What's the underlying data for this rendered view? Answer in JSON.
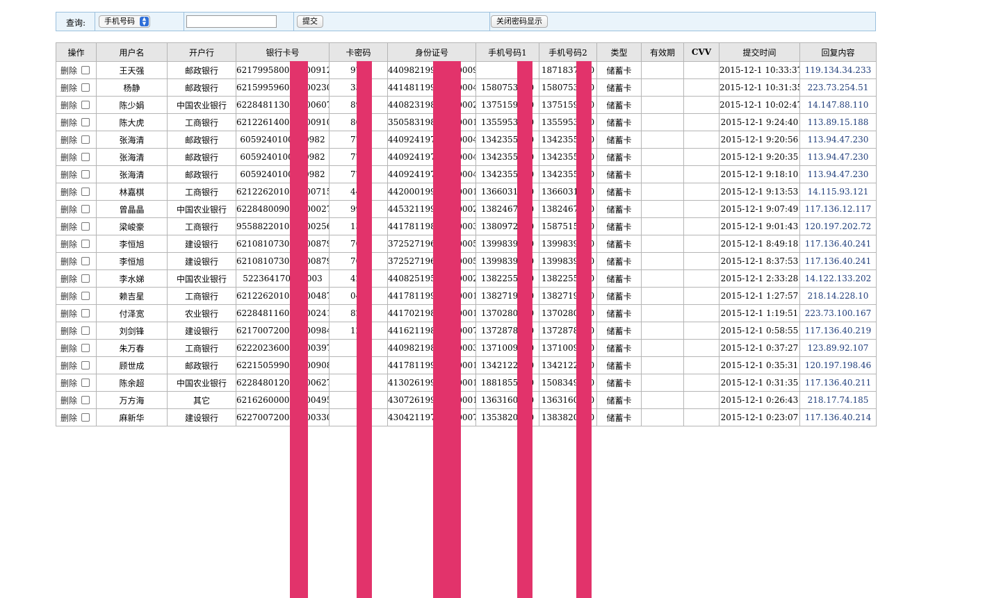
{
  "toolbar": {
    "query_label": "查询:",
    "select_value": "手机号码",
    "search_value": "",
    "submit_label": "提交",
    "toggle_label": "关闭密码显示"
  },
  "columns": [
    "操作",
    "用户名",
    "开户行",
    "银行卡号",
    "卡密码",
    "身份证号",
    "手机号码1",
    "手机号码2",
    "类型",
    "有效期",
    "CVV",
    "提交时间",
    "回复内容"
  ],
  "delete_label": "删除",
  "rows": [
    {
      "user": "王天强",
      "bank": "邮政银行",
      "card": "6217995800000009126",
      "pin": "971",
      "id": "440982199000000095",
      "phone1": "",
      "phone2": "1871837000",
      "type": "储蓄卡",
      "expiry": "",
      "cvv": "",
      "time": "2015-12-1 10:33:37",
      "reply": "119.134.34.233"
    },
    {
      "user": "杨静",
      "bank": "邮政银行",
      "card": "6215995960000002303",
      "pin": "334",
      "id": "441481199700000049",
      "phone1": "1580753300",
      "phone2": "1580753300",
      "type": "储蓄卡",
      "expiry": "",
      "cvv": "",
      "time": "2015-12-1 10:31:35",
      "reply": "223.73.254.51"
    },
    {
      "user": "陈少娟",
      "bank": "中国农业银行",
      "card": "6228481130000006076",
      "pin": "892",
      "id": "440823198900000021",
      "phone1": "1375159100",
      "phone2": "1375159100",
      "type": "储蓄卡",
      "expiry": "",
      "cvv": "",
      "time": "2015-12-1 10:02:47",
      "reply": "14.147.88.110"
    },
    {
      "user": "陈大虎",
      "bank": "工商银行",
      "card": "6212261400000009100",
      "pin": "860",
      "id": "350583198600000013",
      "phone1": "1355953800",
      "phone2": "1355953800",
      "type": "储蓄卡",
      "expiry": "",
      "cvv": "",
      "time": "2015-12-1 9:24:40",
      "reply": "113.89.15.188"
    },
    {
      "user": "张海清",
      "bank": "邮政银行",
      "card": "6059240100000982",
      "pin": "771",
      "id": "440924197700000049",
      "phone1": "1342355300",
      "phone2": "1342355300",
      "type": "储蓄卡",
      "expiry": "",
      "cvv": "",
      "time": "2015-12-1 9:20:56",
      "reply": "113.94.47.230"
    },
    {
      "user": "张海清",
      "bank": "邮政银行",
      "card": "6059240100000982",
      "pin": "771",
      "id": "440924197700000049",
      "phone1": "1342355300",
      "phone2": "1342355300",
      "type": "储蓄卡",
      "expiry": "",
      "cvv": "",
      "time": "2015-12-1 9:20:35",
      "reply": "113.94.47.230"
    },
    {
      "user": "张海清",
      "bank": "邮政银行",
      "card": "6059240100000982",
      "pin": "771",
      "id": "440924197700000049",
      "phone1": "1342355300",
      "phone2": "1342355300",
      "type": "储蓄卡",
      "expiry": "",
      "cvv": "",
      "time": "2015-12-1 9:18:10",
      "reply": "113.94.47.230"
    },
    {
      "user": "林嘉棋",
      "bank": "工商银行",
      "card": "6212262010000007153",
      "pin": "442",
      "id": "442000199500000019",
      "phone1": "1366031200",
      "phone2": "1366031200",
      "type": "储蓄卡",
      "expiry": "",
      "cvv": "",
      "time": "2015-12-1 9:13:53",
      "reply": "14.115.93.121"
    },
    {
      "user": "曾晶晶",
      "bank": "中国农业银行",
      "card": "6228480090000000271",
      "pin": "994",
      "id": "445321199900000023",
      "phone1": "1382467400",
      "phone2": "1382467400",
      "type": "储蓄卡",
      "expiry": "",
      "cvv": "",
      "time": "2015-12-1 9:07:49",
      "reply": "117.136.12.117"
    },
    {
      "user": "梁峻豪",
      "bank": "工商银行",
      "card": "9558822010000002569",
      "pin": "136",
      "id": "441781198200000039",
      "phone1": "1380972200",
      "phone2": "1587515200",
      "type": "储蓄卡",
      "expiry": "",
      "cvv": "",
      "time": "2015-12-1 9:01:43",
      "reply": "120.197.202.72"
    },
    {
      "user": "李恒旭",
      "bank": "建设银行",
      "card": "6210810730000008798",
      "pin": "700",
      "id": "372527196900000052",
      "phone1": "1399839300",
      "phone2": "1399839300",
      "type": "储蓄卡",
      "expiry": "",
      "cvv": "",
      "time": "2015-12-1 8:49:18",
      "reply": "117.136.40.241"
    },
    {
      "user": "李恒旭",
      "bank": "建设银行",
      "card": "6210810730000008798",
      "pin": "700",
      "id": "372527196900000052",
      "phone1": "1399839300",
      "phone2": "1399839300",
      "type": "储蓄卡",
      "expiry": "",
      "cvv": "",
      "time": "2015-12-1 8:37:53",
      "reply": "117.136.40.241"
    },
    {
      "user": "李水娣",
      "bank": "中国农业银行",
      "card": "522364170000003",
      "pin": "423",
      "id": "440825195000000022",
      "phone1": "1382255700",
      "phone2": "1382255700",
      "type": "储蓄卡",
      "expiry": "",
      "cvv": "",
      "time": "2015-12-1 2:33:28",
      "reply": "14.122.133.202"
    },
    {
      "user": "赖吉星",
      "bank": "工商银行",
      "card": "6212262010000004878",
      "pin": "041",
      "id": "441781199400000017",
      "phone1": "1382719000",
      "phone2": "1382719000",
      "type": "储蓄卡",
      "expiry": "",
      "cvv": "",
      "time": "2015-12-1 1:27:57",
      "reply": "218.14.228.10"
    },
    {
      "user": "付泽宽",
      "bank": "农业银行",
      "card": "6228481160000002414",
      "pin": "829",
      "id": "441702198200000010",
      "phone1": "1370280000",
      "phone2": "1370280000",
      "type": "储蓄卡",
      "expiry": "",
      "cvv": "",
      "time": "2015-12-1 1:19:51",
      "reply": "223.73.100.167"
    },
    {
      "user": "刘剑锋",
      "bank": "建设银行",
      "card": "6217007200000009844",
      "pin": "120",
      "id": "441621198700000079",
      "phone1": "1372878500",
      "phone2": "1372878500",
      "type": "储蓄卡",
      "expiry": "",
      "cvv": "",
      "time": "2015-12-1 0:58:55",
      "reply": "117.136.40.219"
    },
    {
      "user": "朱万春",
      "bank": "工商银行",
      "card": "6222023600000003977",
      "pin": "",
      "id": "440982198800000030",
      "phone1": "1371009200",
      "phone2": "1371009200",
      "type": "储蓄卡",
      "expiry": "",
      "cvv": "",
      "time": "2015-12-1 0:37:27",
      "reply": "123.89.92.107"
    },
    {
      "user": "顾世成",
      "bank": "邮政银行",
      "card": "6221505990000009080",
      "pin": "",
      "id": "44178119900000001X",
      "phone1": "1342122700",
      "phone2": "1342122700",
      "type": "储蓄卡",
      "expiry": "",
      "cvv": "",
      "time": "2015-12-1 0:35:31",
      "reply": "120.197.198.46"
    },
    {
      "user": "陈余超",
      "bank": "中国农业银行",
      "card": "6228480120000006272",
      "pin": "",
      "id": "413026199800000018",
      "phone1": "1881855100",
      "phone2": "1508349100",
      "type": "储蓄卡",
      "expiry": "",
      "cvv": "",
      "time": "2015-12-1 0:31:35",
      "reply": "117.136.40.211"
    },
    {
      "user": "万方海",
      "bank": "其它",
      "card": "6216260000000004951",
      "pin": "",
      "id": "430726199000000019",
      "phone1": "1363160600",
      "phone2": "1363160600",
      "type": "储蓄卡",
      "expiry": "",
      "cvv": "",
      "time": "2015-12-1 0:26:43",
      "reply": "218.17.74.185"
    },
    {
      "user": "麻新华",
      "bank": "建设银行",
      "card": "6227007200000003305",
      "pin": "",
      "id": "43042119730000007X",
      "phone1": "1353820900",
      "phone2": "1383820900",
      "type": "储蓄卡",
      "expiry": "",
      "cvv": "",
      "time": "2015-12-1 0:23:07",
      "reply": "117.136.40.214"
    }
  ]
}
